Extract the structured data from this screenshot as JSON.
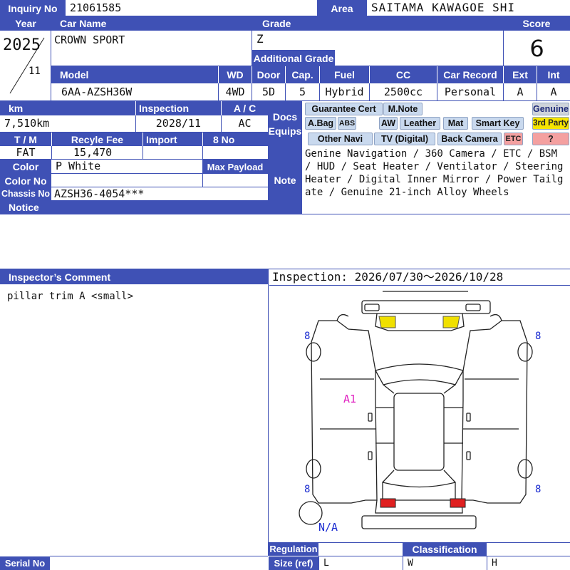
{
  "labels": {
    "inquiry_no": "Inquiry No",
    "area": "Area",
    "year": "Year",
    "car_name": "Car Name",
    "grade": "Grade",
    "score": "Score",
    "additional_grade": "Additional Grade",
    "model": "Model",
    "wd": "WD",
    "door": "Door",
    "cap": "Cap.",
    "fuel": "Fuel",
    "cc": "CC",
    "car_record": "Car Record",
    "ext": "Ext",
    "int": "Int",
    "km": "km",
    "inspection": "Inspection",
    "ac": "A / C",
    "docs": "Docs",
    "equips": "Equips",
    "tm": "T / M",
    "recycle_fee": "Recyle Fee",
    "import": "Import",
    "eight_no": "8 No",
    "color": "Color",
    "max_payload": "Max Payload",
    "color_no": "Color No",
    "note": "Note",
    "chassis_no": "Chassis No",
    "notice": "Notice",
    "inspectors_comment": "Inspector’s Comment",
    "regulation": "Regulation",
    "size_ref": "Size (ref)",
    "classification": "Classification",
    "serial_no": "Serial No",
    "size_l": "L",
    "size_w": "W",
    "size_h": "H"
  },
  "values": {
    "inquiry_no": "21061585",
    "area": "SAITAMA KAWAGOE SHI",
    "year": "2025",
    "month": "11",
    "car_name": "CROWN SPORT",
    "grade": "Z",
    "additional_grade": "",
    "score": "6",
    "model": "6AA-AZSH36W",
    "wd": "4WD",
    "door": "5D",
    "cap": "5",
    "fuel": "Hybrid",
    "cc": "2500cc",
    "car_record": "Personal",
    "ext": "A",
    "int": "A",
    "km": "7,510km",
    "inspection": "2028/11",
    "ac": "AC",
    "tm": "FAT",
    "recycle_fee": "15,470",
    "import": "",
    "eight_no": "",
    "color": "P White",
    "max_payload": "",
    "color_no": "",
    "chassis_no": "AZSH36-4054***",
    "note": "Genine Navigation / 360 Camera / ETC / BSM / HUD / Seat Heater / Ventilator / Steering Heater / Digital Inner Mirror / Power Tailgate / Genuine 21-inch Alloy Wheels",
    "notice": "",
    "inspectors_comment": "pillar trim A <small>",
    "inspection_period": "Inspection: 2026/07/30〜2026/10/28",
    "serial_no": ""
  },
  "equipment": {
    "guarantee_cert": "Guarantee Cert",
    "m_note": "M.Note",
    "genuine": "Genuine",
    "a_bag": "A.Bag",
    "abs": "ABS",
    "aw": "AW",
    "leather": "Leather",
    "mat": "Mat",
    "smart_key": "Smart Key",
    "third_party": "3rd Party",
    "other_navi": "Other Navi",
    "tv_digital": "TV (Digital)",
    "back_camera": "Back Camera",
    "etc": "ETC",
    "question": "?"
  },
  "diagram": {
    "damage_code": "A1",
    "tire_fl": "8",
    "tire_fr": "8",
    "tire_rl": "8",
    "tire_rr": "8",
    "spare": "N/A"
  },
  "colors": {
    "header": "#3f51b5",
    "equip_fill": "#c9d9ee",
    "equip_gray": "#cfd4da",
    "third_party": "#f6e500",
    "question": "#f4a0a0",
    "headlight": "#f0e000",
    "taillight": "#e02020",
    "damage_code": "#e020c0",
    "tire_number": "#1a2bd0"
  }
}
